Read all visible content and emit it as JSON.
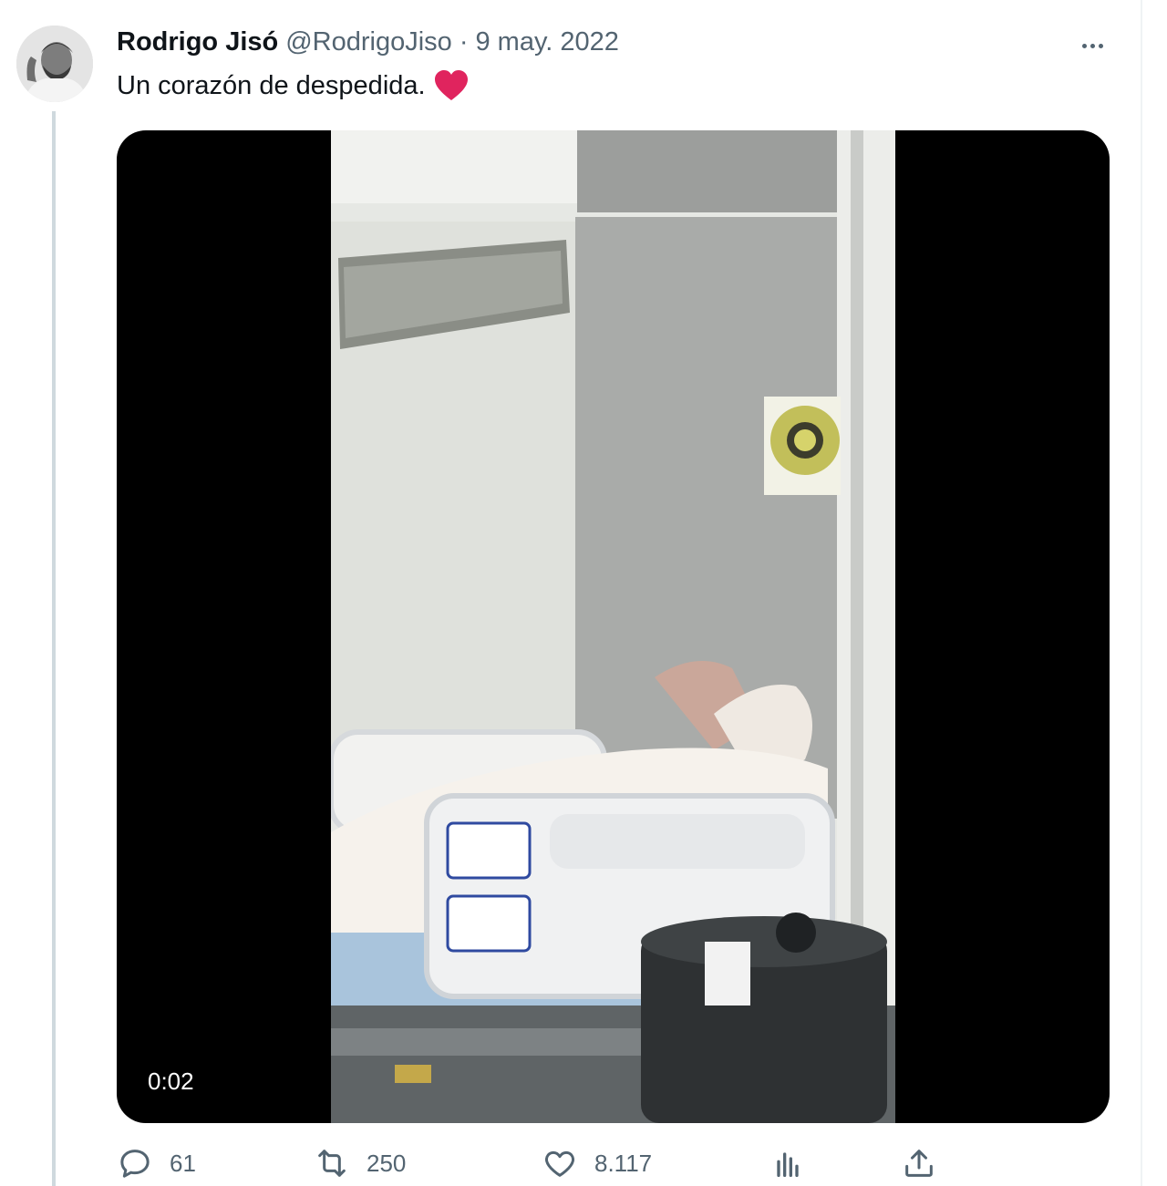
{
  "tweet": {
    "author_name": "Rodrigo Jisó",
    "handle": "@RodrigoJiso",
    "separator": "·",
    "date": "9 may. 2022",
    "text": "Un corazón de despedida.",
    "text_emoji": "heart-emoji"
  },
  "media": {
    "type": "video",
    "timestamp": "0:02"
  },
  "actions": {
    "replies": "61",
    "retweets": "250",
    "likes": "8.117",
    "views_icon": "bar-chart-icon",
    "share_icon": "share-icon"
  },
  "colors": {
    "text_primary": "#0f1419",
    "text_secondary": "#536471",
    "thread_line": "#cfd9de",
    "heart": "#e0245e"
  }
}
